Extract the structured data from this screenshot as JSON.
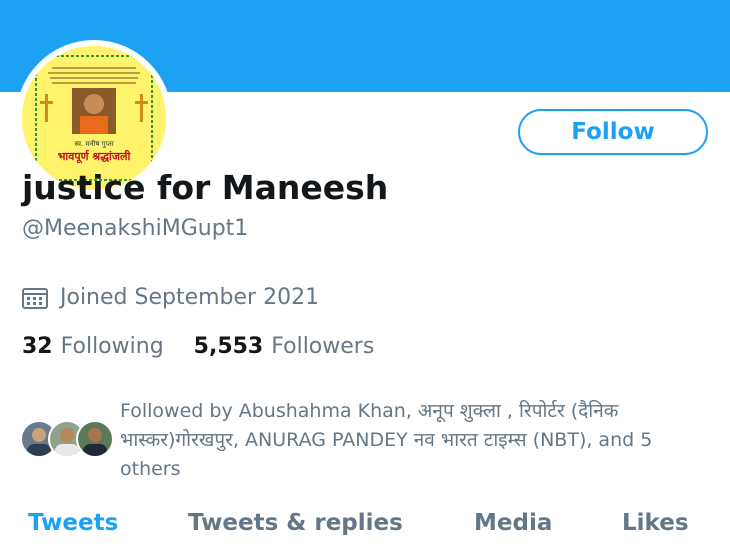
{
  "colors": {
    "accent": "#1da1f2",
    "text_primary": "#14171a",
    "text_secondary": "#657786"
  },
  "profile": {
    "display_name": "justice for Maneesh",
    "handle": "@MeenakshiMGupt1",
    "joined_icon": "calendar-icon",
    "joined": "Joined September 2021",
    "follow_label": "Follow",
    "avatar_icon": "tribute-poster-avatar",
    "avatar_caption_small": "स्व. मनीष गुप्ता",
    "avatar_caption_large": "भावपूर्ण श्रद्धांजली"
  },
  "stats": {
    "following_count": "32",
    "following_label": "Following",
    "followers_count": "5,553",
    "followers_label": "Followers"
  },
  "followed_by": {
    "text": "Followed by Abushahma Khan, अनूप शुक्ला , रिपोर्टर (दैनिक भास्कर)गोरखपुर, ANURAG PANDEY नव भारत टाइम्स (NBT), and 5 others"
  },
  "tabs": [
    {
      "label": "Tweets",
      "active": true
    },
    {
      "label": "Tweets & replies",
      "active": false
    },
    {
      "label": "Media",
      "active": false
    },
    {
      "label": "Likes",
      "active": false
    }
  ]
}
